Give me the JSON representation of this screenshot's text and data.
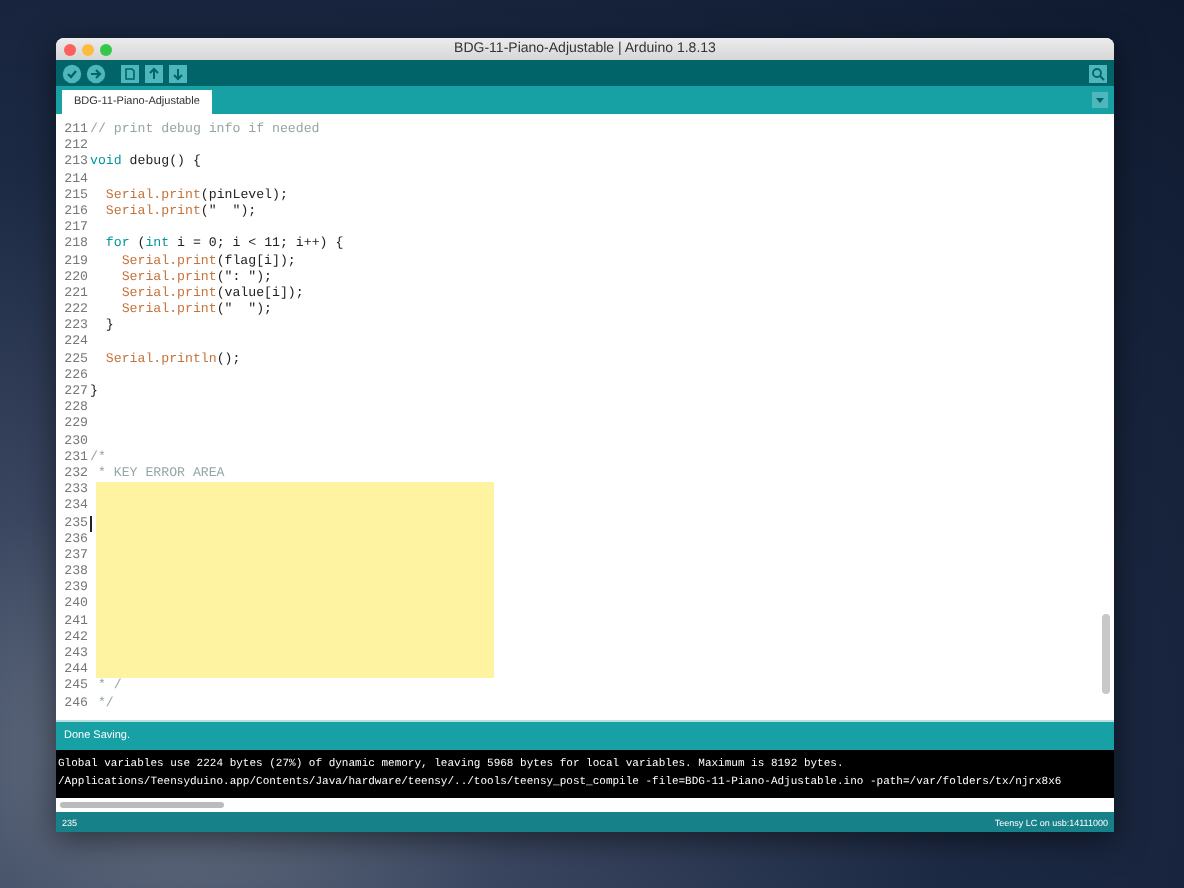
{
  "window": {
    "title": "BDG-11-Piano-Adjustable | Arduino 1.8.13"
  },
  "tabs": [
    {
      "label": "BDG-11-Piano-Adjustable",
      "selected": true
    }
  ],
  "editor": {
    "lines": [
      {
        "number": "211",
        "highlighted": false,
        "cursor": false,
        "tokens": [
          {
            "kind": "comment",
            "text": "// print debug info if needed"
          }
        ]
      },
      {
        "number": "212",
        "highlighted": false,
        "cursor": false
      },
      {
        "number": "213",
        "highlighted": false,
        "cursor": false,
        "tokens": [
          {
            "kind": "keyword",
            "text": "void"
          },
          {
            "kind": "plain",
            "text": " debug() {"
          }
        ]
      },
      {
        "number": "214",
        "highlighted": false,
        "cursor": false
      },
      {
        "number": "215",
        "highlighted": false,
        "cursor": false,
        "tokens": [
          {
            "kind": "function",
            "text": "  Serial.print"
          },
          {
            "kind": "plain",
            "text": "(pinLevel);"
          }
        ]
      },
      {
        "number": "216",
        "highlighted": false,
        "cursor": false,
        "tokens": [
          {
            "kind": "function",
            "text": "  Serial.print"
          },
          {
            "kind": "plain",
            "text": "(\"  \");"
          }
        ]
      },
      {
        "number": "217",
        "highlighted": false,
        "cursor": false
      },
      {
        "number": "218",
        "highlighted": false,
        "cursor": false,
        "tokens": [
          {
            "kind": "keyword",
            "text": "  for"
          },
          {
            "kind": "plain",
            "text": " ("
          },
          {
            "kind": "keyword",
            "text": "int"
          },
          {
            "kind": "plain",
            "text": " i = 0; i < 11; i++) {"
          }
        ]
      },
      {
        "number": "219",
        "highlighted": false,
        "cursor": false,
        "tokens": [
          {
            "kind": "function",
            "text": "    Serial.print"
          },
          {
            "kind": "plain",
            "text": "(flag[i]);"
          }
        ]
      },
      {
        "number": "220",
        "highlighted": false,
        "cursor": false,
        "tokens": [
          {
            "kind": "function",
            "text": "    Serial.print"
          },
          {
            "kind": "plain",
            "text": "(\": \");"
          }
        ]
      },
      {
        "number": "221",
        "highlighted": false,
        "cursor": false,
        "tokens": [
          {
            "kind": "function",
            "text": "    Serial.print"
          },
          {
            "kind": "plain",
            "text": "(value[i]);"
          }
        ]
      },
      {
        "number": "222",
        "highlighted": false,
        "cursor": false,
        "tokens": [
          {
            "kind": "function",
            "text": "    Serial.print"
          },
          {
            "kind": "plain",
            "text": "(\"  \");"
          }
        ]
      },
      {
        "number": "223",
        "highlighted": false,
        "cursor": false,
        "tokens": [
          {
            "kind": "plain",
            "text": "  }"
          }
        ]
      },
      {
        "number": "224",
        "highlighted": false,
        "cursor": false
      },
      {
        "number": "225",
        "highlighted": false,
        "cursor": false,
        "tokens": [
          {
            "kind": "function",
            "text": "  Serial.println"
          },
          {
            "kind": "plain",
            "text": "();"
          }
        ]
      },
      {
        "number": "226",
        "highlighted": false,
        "cursor": false
      },
      {
        "number": "227",
        "highlighted": false,
        "cursor": false,
        "tokens": [
          {
            "kind": "plain",
            "text": "}"
          }
        ]
      },
      {
        "number": "228",
        "highlighted": false,
        "cursor": false
      },
      {
        "number": "229",
        "highlighted": false,
        "cursor": false
      },
      {
        "number": "230",
        "highlighted": false,
        "cursor": false
      },
      {
        "number": "231",
        "highlighted": false,
        "cursor": false,
        "tokens": [
          {
            "kind": "comment",
            "text": "/*"
          }
        ]
      },
      {
        "number": "232",
        "highlighted": false,
        "cursor": false,
        "tokens": [
          {
            "kind": "comment",
            "text": " * KEY ERROR AREA"
          }
        ]
      },
      {
        "number": "233",
        "highlighted": true,
        "cursor": false
      },
      {
        "number": "234",
        "highlighted": true,
        "cursor": false
      },
      {
        "number": "235",
        "highlighted": true,
        "cursor": true
      },
      {
        "number": "236",
        "highlighted": true,
        "cursor": false
      },
      {
        "number": "237",
        "highlighted": true,
        "cursor": false
      },
      {
        "number": "238",
        "highlighted": true,
        "cursor": false
      },
      {
        "number": "239",
        "highlighted": true,
        "cursor": false
      },
      {
        "number": "240",
        "highlighted": true,
        "cursor": false
      },
      {
        "number": "241",
        "highlighted": true,
        "cursor": false
      },
      {
        "number": "242",
        "highlighted": true,
        "cursor": false
      },
      {
        "number": "243",
        "highlighted": true,
        "cursor": false
      },
      {
        "number": "244",
        "highlighted": true,
        "cursor": false
      },
      {
        "number": "245",
        "highlighted": false,
        "cursor": false,
        "tokens": [
          {
            "kind": "comment",
            "text": " * /"
          }
        ]
      },
      {
        "number": "246",
        "highlighted": false,
        "cursor": false,
        "tokens": [
          {
            "kind": "comment",
            "text": " */"
          }
        ]
      }
    ]
  },
  "message": "Done Saving.",
  "console": [
    "Global variables use 2224 bytes (27%) of dynamic memory, leaving 5968 bytes for local variables. Maximum is 8192 bytes.",
    "/Applications/Teensyduino.app/Contents/Java/hardware/teensy/../tools/teensy_post_compile -file=BDG-11-Piano-Adjustable.ino -path=/var/folders/tx/njrx8x6"
  ],
  "status_bar": {
    "line": "235",
    "board": "Teensy LC on usb:14111000"
  }
}
